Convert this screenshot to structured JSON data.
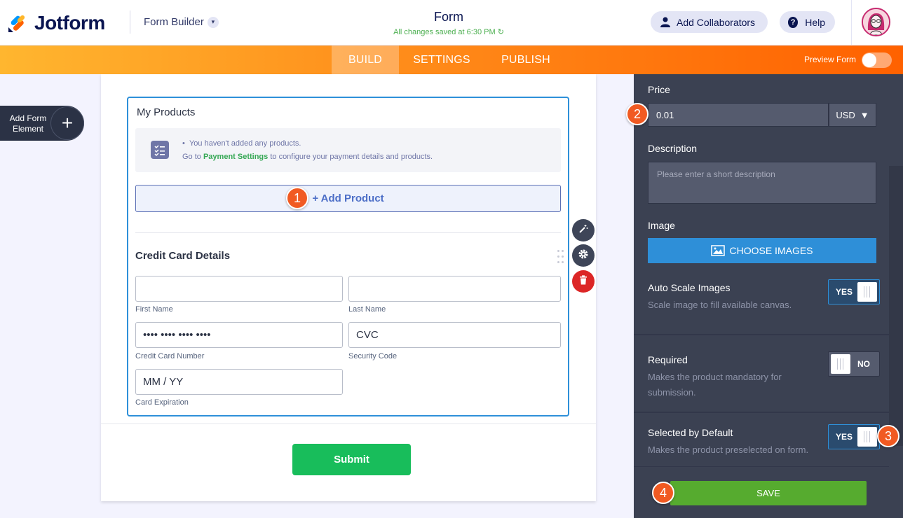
{
  "header": {
    "logo_text": "Jotform",
    "builder_label": "Form Builder",
    "form_title": "Form",
    "saved_status": "All changes saved at 6:30 PM",
    "collaborators_label": "Add Collaborators",
    "help_label": "Help"
  },
  "nav": {
    "tabs": [
      {
        "label": "BUILD",
        "active": true
      },
      {
        "label": "SETTINGS",
        "active": false
      },
      {
        "label": "PUBLISH",
        "active": false
      }
    ],
    "preview_label": "Preview Form",
    "preview_on": false
  },
  "sidebar": {
    "add_element_label": "Add Form Element",
    "plus": "+"
  },
  "form": {
    "products_title": "My Products",
    "empty_line1": "You haven't added any products.",
    "empty_line2_pre": "Go to ",
    "empty_line2_link": "Payment Settings",
    "empty_line2_post": " to configure your payment details and products.",
    "add_product_label": "+ Add Product",
    "cc_title": "Credit Card Details",
    "fields": {
      "first_name_label": "First Name",
      "last_name_label": "Last Name",
      "card_number_value": "•••• •••• •••• ••••",
      "card_number_label": "Credit Card Number",
      "cvc_value": "CVC",
      "cvc_label": "Security Code",
      "expiry_value": "MM / YY",
      "expiry_label": "Card Expiration"
    },
    "submit_label": "Submit"
  },
  "panel": {
    "price_label": "Price",
    "price_value": "0.01",
    "currency": "USD",
    "description_label": "Description",
    "description_placeholder": "Please enter a short description",
    "image_label": "Image",
    "choose_images_label": "CHOOSE IMAGES",
    "auto_scale": {
      "label": "Auto Scale Images",
      "sub": "Scale image to fill available canvas.",
      "value": "YES"
    },
    "required": {
      "label": "Required",
      "sub": "Makes the product mandatory for submission.",
      "value": "NO"
    },
    "selected_default": {
      "label": "Selected by Default",
      "sub": "Makes the product preselected on form.",
      "value": "YES"
    },
    "save_label": "SAVE"
  },
  "callouts": [
    "1",
    "2",
    "3",
    "4"
  ],
  "colors": {
    "brand_orange": "#ff6100",
    "accent_blue": "#2e90d9",
    "submit_green": "#18bd5b",
    "save_green": "#56ab2f",
    "callout": "#f15a22"
  }
}
